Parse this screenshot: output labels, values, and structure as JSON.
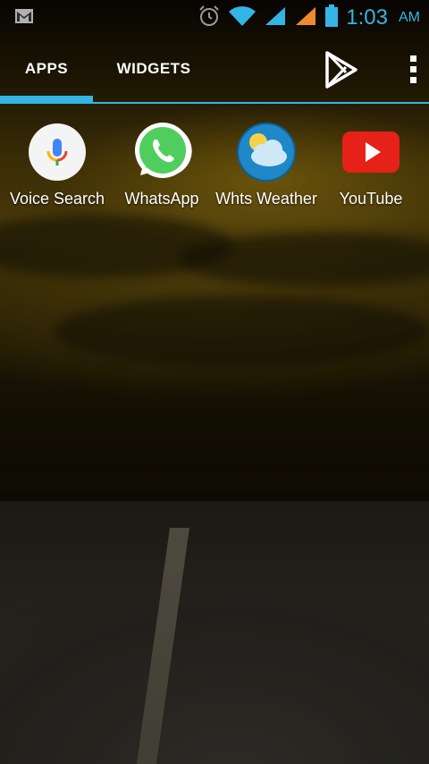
{
  "status_bar": {
    "notification_icon": "gmail-icon",
    "icons": [
      "alarm-icon",
      "wifi-icon",
      "signal-icon",
      "signal-icon",
      "battery-icon"
    ],
    "time": "1:03",
    "ampm": "AM"
  },
  "tabs": [
    {
      "label": "APPS",
      "selected": true
    },
    {
      "label": "WIDGETS",
      "selected": false
    }
  ],
  "toolbar": {
    "store_icon": "play-store-icon",
    "menu_icon": "overflow-menu-icon"
  },
  "apps": [
    {
      "label": "Voice Search",
      "icon": "microphone-icon"
    },
    {
      "label": "WhatsApp",
      "icon": "whatsapp-icon"
    },
    {
      "label": "Whts Weather",
      "icon": "weather-icon"
    },
    {
      "label": "YouTube",
      "icon": "youtube-icon"
    }
  ],
  "colors": {
    "accent": "#33b5e5",
    "whatsapp": "#4fce5d",
    "youtube": "#e62117",
    "weather": "#1e88c8"
  }
}
